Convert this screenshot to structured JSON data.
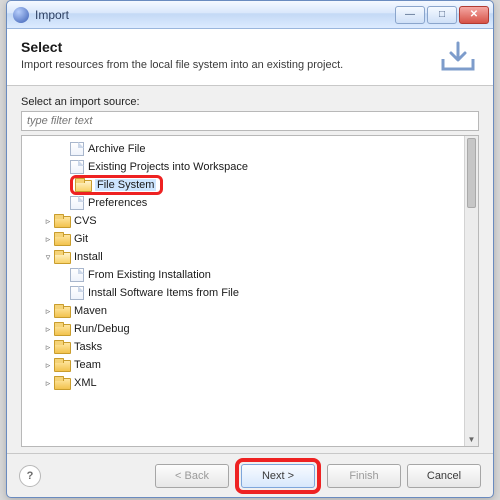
{
  "window": {
    "title": "Import"
  },
  "banner": {
    "title": "Select",
    "description": "Import resources from the local file system into an existing project."
  },
  "body": {
    "label": "Select an import source:",
    "filter_placeholder": "type filter text"
  },
  "tree": {
    "items": [
      {
        "depth": 2,
        "icon": "file",
        "label": "Archive File",
        "expander": ""
      },
      {
        "depth": 2,
        "icon": "file",
        "label": "Existing Projects into Workspace",
        "expander": ""
      },
      {
        "depth": 2,
        "icon": "folder-open",
        "label": "File System",
        "expander": "",
        "highlighted": true,
        "selected": true
      },
      {
        "depth": 2,
        "icon": "file",
        "label": "Preferences",
        "expander": ""
      },
      {
        "depth": 1,
        "icon": "folder",
        "label": "CVS",
        "expander": "▹"
      },
      {
        "depth": 1,
        "icon": "folder",
        "label": "Git",
        "expander": "▹"
      },
      {
        "depth": 1,
        "icon": "folder-open",
        "label": "Install",
        "expander": "▿"
      },
      {
        "depth": 2,
        "icon": "file",
        "label": "From Existing Installation",
        "expander": ""
      },
      {
        "depth": 2,
        "icon": "file",
        "label": "Install Software Items from File",
        "expander": ""
      },
      {
        "depth": 1,
        "icon": "folder",
        "label": "Maven",
        "expander": "▹"
      },
      {
        "depth": 1,
        "icon": "folder",
        "label": "Run/Debug",
        "expander": "▹"
      },
      {
        "depth": 1,
        "icon": "folder",
        "label": "Tasks",
        "expander": "▹"
      },
      {
        "depth": 1,
        "icon": "folder",
        "label": "Team",
        "expander": "▹"
      },
      {
        "depth": 1,
        "icon": "folder",
        "label": "XML",
        "expander": "▹"
      }
    ]
  },
  "buttons": {
    "back": "< Back",
    "next": "Next >",
    "finish": "Finish",
    "cancel": "Cancel",
    "help": "?"
  }
}
